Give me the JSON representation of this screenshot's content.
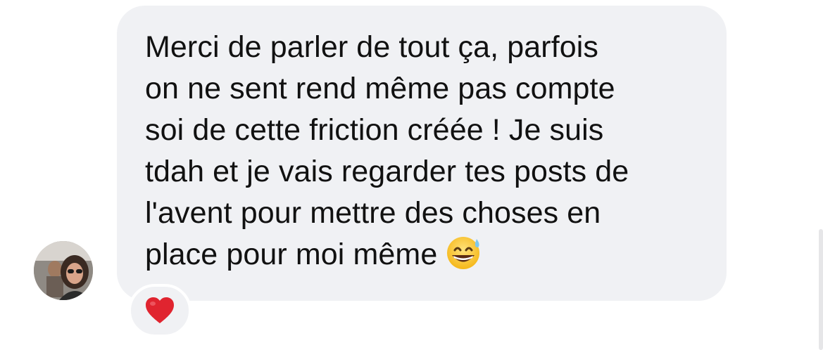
{
  "message": {
    "text": "Merci de parler de tout ça, parfois\non ne sent rend même pas compte\nsoi de cette friction créée ! Je suis\ntdah et je vais regarder tes posts de\nl'avent pour mettre des choses en\nplace pour moi même",
    "trailing_emoji": "grinning-face-with-sweat",
    "bubble_color": "#f0f1f4",
    "text_color": "#111111"
  },
  "sender": {
    "avatar": "profile-photo"
  },
  "reaction": {
    "emoji": "red-heart",
    "color": "#e0242f"
  }
}
